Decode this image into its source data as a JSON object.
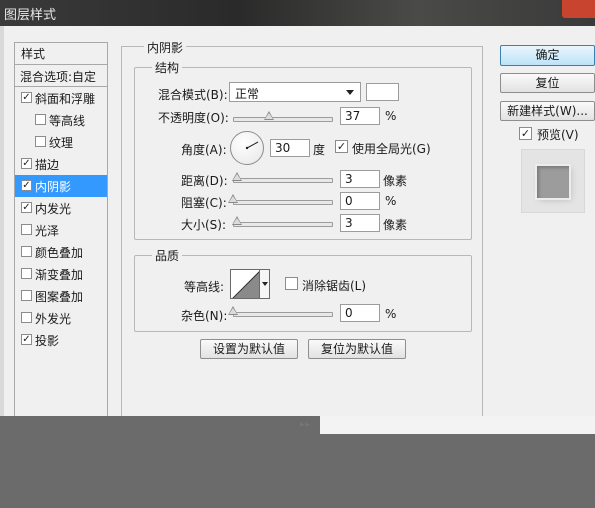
{
  "window": {
    "title": "图层样式"
  },
  "styles_panel": {
    "header": "样式",
    "blend_options": "混合选项:自定",
    "items": [
      {
        "label": "斜面和浮雕",
        "checked": true,
        "sub": false,
        "active": false
      },
      {
        "label": "等高线",
        "checked": false,
        "sub": true,
        "active": false
      },
      {
        "label": "纹理",
        "checked": false,
        "sub": true,
        "active": false
      },
      {
        "label": "描边",
        "checked": true,
        "sub": false,
        "active": false
      },
      {
        "label": "内阴影",
        "checked": true,
        "sub": false,
        "active": true
      },
      {
        "label": "内发光",
        "checked": true,
        "sub": false,
        "active": false
      },
      {
        "label": "光泽",
        "checked": false,
        "sub": false,
        "active": false
      },
      {
        "label": "颜色叠加",
        "checked": false,
        "sub": false,
        "active": false
      },
      {
        "label": "渐变叠加",
        "checked": false,
        "sub": false,
        "active": false
      },
      {
        "label": "图案叠加",
        "checked": false,
        "sub": false,
        "active": false
      },
      {
        "label": "外发光",
        "checked": false,
        "sub": false,
        "active": false
      },
      {
        "label": "投影",
        "checked": true,
        "sub": false,
        "active": false
      }
    ],
    "check_mark": "✓"
  },
  "inner_shadow": {
    "section_title": "内阴影",
    "structure": {
      "title": "结构",
      "blend_mode_label": "混合模式(B):",
      "blend_mode_value": "正常",
      "blend_color": "#ffffff",
      "opacity_label": "不透明度(O):",
      "opacity_value": "37",
      "opacity_unit": "%",
      "angle_label": "角度(A):",
      "angle_value": "30",
      "angle_unit": "度",
      "global_light_label": "使用全局光(G)",
      "global_light_checked": true,
      "distance_label": "距离(D):",
      "distance_value": "3",
      "distance_unit": "像素",
      "choke_label": "阻塞(C):",
      "choke_value": "0",
      "choke_unit": "%",
      "size_label": "大小(S):",
      "size_value": "3",
      "size_unit": "像素"
    },
    "quality": {
      "title": "品质",
      "contour_label": "等高线:",
      "antialias_label": "消除锯齿(L)",
      "antialias_checked": false,
      "noise_label": "杂色(N):",
      "noise_value": "0",
      "noise_unit": "%"
    },
    "set_default_button": "设置为默认值",
    "reset_default_button": "复位为默认值"
  },
  "buttons": {
    "ok": "确定",
    "reset": "复位",
    "new_style": "新建样式(W)...",
    "preview_label": "预览(V)",
    "preview_checked": true
  },
  "colors": {
    "active_item": "#3399ff",
    "primary_button": "#bde3f8",
    "close_button": "#c8442f"
  }
}
